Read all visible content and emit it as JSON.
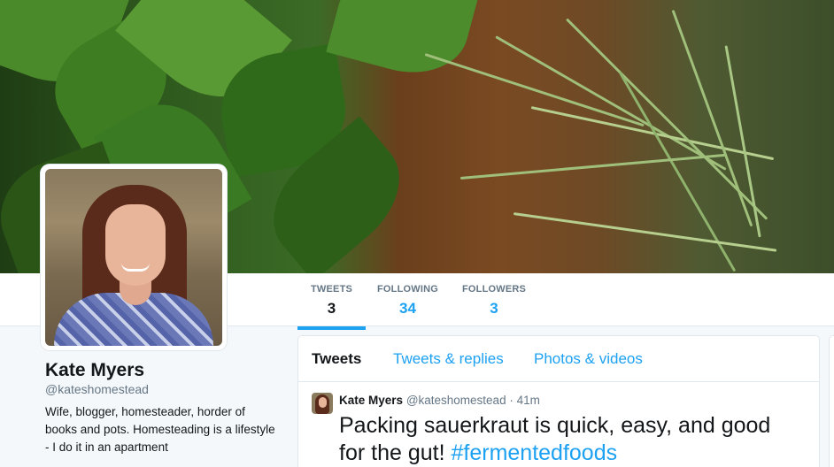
{
  "profile": {
    "name": "Kate Myers",
    "handle": "@kateshomestead",
    "bio": "Wife, blogger, homesteader, horder of books and pots. Homesteading is a lifestyle - I do it in an apartment"
  },
  "stats": [
    {
      "label": "TWEETS",
      "value": "3",
      "active": true
    },
    {
      "label": "FOLLOWING",
      "value": "34",
      "active": false
    },
    {
      "label": "FOLLOWERS",
      "value": "3",
      "active": false
    }
  ],
  "tabs": [
    {
      "label": "Tweets",
      "active": true
    },
    {
      "label": "Tweets & replies",
      "active": false
    },
    {
      "label": "Photos & videos",
      "active": false
    }
  ],
  "tweet": {
    "author_name": "Kate Myers",
    "author_handle": "@kateshomestead",
    "separator": "·",
    "time": "41m",
    "text": "Packing sauerkraut is quick, easy, and good for the gut!",
    "hashtag": "#fermentedfoods"
  },
  "colors": {
    "accent": "#1da1f2",
    "text": "#14171a",
    "muted": "#657786",
    "background": "#f5f8fa"
  }
}
